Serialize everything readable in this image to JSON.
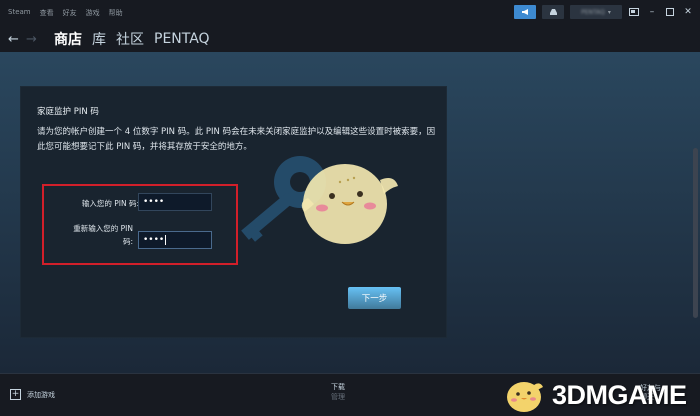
{
  "menu": {
    "items": [
      "Steam",
      "查看",
      "好友",
      "游戏",
      "帮助"
    ]
  },
  "window": {
    "account_name": "PENTAQ",
    "controls": [
      "minimize-icon",
      "maximize-icon",
      "close-icon"
    ]
  },
  "nav": {
    "back_icon": "back-arrow-icon",
    "forward_icon": "forward-arrow-icon",
    "tabs": [
      "商店",
      "库",
      "社区",
      "PENTAQ"
    ],
    "active_tab": "商店"
  },
  "dialog": {
    "title": "家庭监护 PIN 码",
    "description": "请为您的帐户创建一个 4 位数字 PIN 码。此 PIN 码会在未来关闭家庭监护以及编辑这些设置时被索要，因此您可能想要记下此 PIN 码，并将其存放于安全的地方。",
    "pin_label": "输入您的 PIN 码:",
    "pin_value": "••••",
    "confirm_label_line1": "重新输入您的 PIN",
    "confirm_label_line2": "码:",
    "confirm_value": "••••",
    "next_button": "下一步"
  },
  "bottom": {
    "add_game": "添加游戏",
    "downloads_title": "下载",
    "downloads_sub": "管理",
    "friends_chat": "好友与\n聊天"
  },
  "watermark": {
    "text": "3DMGAME"
  },
  "colors": {
    "accent": "#3d8ad1",
    "highlight_border": "#d21f2a",
    "background": "#1b2838",
    "topbar": "#171a21"
  }
}
